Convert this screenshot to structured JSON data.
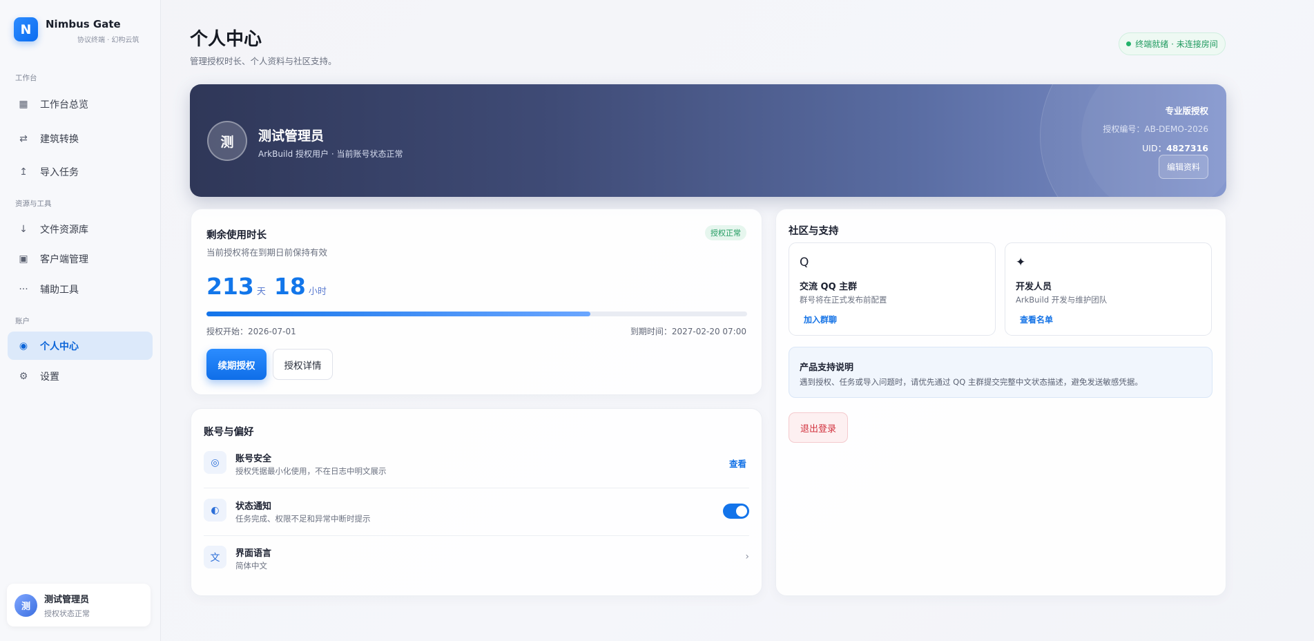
{
  "brand": {
    "logo": "N",
    "name": "Nimbus Gate",
    "subtitle": "协议终端 · 幻构云筑"
  },
  "sidebar": {
    "sections": [
      {
        "label": "工作台"
      },
      {
        "label": "资源与工具"
      },
      {
        "label": "账户"
      }
    ],
    "items": [
      {
        "label": "工作台总览",
        "icon": "grid-icon"
      },
      {
        "label": "建筑转换",
        "icon": "swap-icon"
      },
      {
        "label": "导入任务",
        "icon": "upload-icon"
      },
      {
        "label": "文件资源库",
        "icon": "download-icon"
      },
      {
        "label": "客户端管理",
        "icon": "window-icon"
      },
      {
        "label": "辅助工具",
        "icon": "more-icon"
      },
      {
        "label": "个人中心",
        "icon": "target-icon",
        "active": true
      },
      {
        "label": "设置",
        "icon": "gear-icon"
      }
    ],
    "user": {
      "avatar": "测",
      "name": "测试管理员",
      "status": "授权状态正常"
    }
  },
  "header": {
    "title": "个人中心",
    "subtitle": "管理授权时长、个人资料与社区支持。",
    "status": "终端就绪 · 未连接房间"
  },
  "hero": {
    "avatar": "测",
    "name": "测试管理员",
    "desc": "ArkBuild 授权用户 · 当前账号状态正常",
    "tier": "专业版授权",
    "license": "授权编号：AB-DEMO-2026",
    "uid_label": "UID：",
    "uid_value": "4827316",
    "edit": "编辑资料"
  },
  "license": {
    "title": "剩余使用时长",
    "badge": "授权正常",
    "subtitle": "当前授权将在到期日前保持有效",
    "days": "213",
    "days_unit": "天",
    "hours": "18",
    "hours_unit": "小时",
    "progress": 0.71,
    "start": "授权开始：2026-07-01",
    "end": "到期时间：2027-02-20 07:00",
    "renew": "续期授权",
    "details": "授权详情"
  },
  "account": {
    "title": "账号与偏好",
    "rows": [
      {
        "icon": "shield-icon",
        "glyph": "◎",
        "title": "账号安全",
        "desc": "授权凭据最小化使用，不在日志中明文展示",
        "action": "查看"
      },
      {
        "icon": "notify-icon",
        "glyph": "◐",
        "title": "状态通知",
        "desc": "任务完成、权限不足和异常中断时提示",
        "toggle": true
      },
      {
        "icon": "language-icon",
        "glyph": "文",
        "title": "界面语言",
        "desc": "简体中文"
      }
    ]
  },
  "community": {
    "title": "社区与支持",
    "cards": [
      {
        "icon": "search-icon",
        "glyph": "Q",
        "title": "交流 QQ 主群",
        "desc": "群号将在正式发布前配置",
        "action": "加入群聊"
      },
      {
        "icon": "sparkle-icon",
        "glyph": "✦",
        "title": "开发人员",
        "desc": "ArkBuild 开发与维护团队",
        "action": "查看名单"
      }
    ],
    "support_title": "产品支持说明",
    "support_desc": "遇到授权、任务或导入问题时，请优先通过 QQ 主群提交完整中文状态描述，避免发送敏感凭据。",
    "logout": "退出登录"
  }
}
